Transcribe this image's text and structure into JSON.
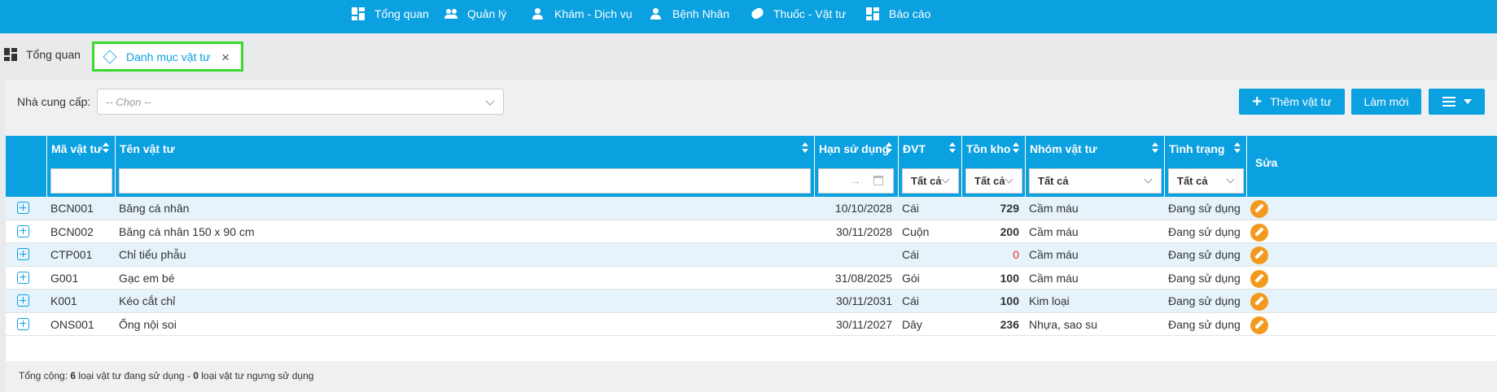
{
  "nav": {
    "items": [
      {
        "label": "Tổng quan",
        "icon": "dashboard-icon"
      },
      {
        "label": "Quản lý",
        "icon": "users-icon"
      },
      {
        "label": "Khám - Dịch vụ",
        "icon": "doctor-icon"
      },
      {
        "label": "Bệnh Nhân",
        "icon": "patient-icon"
      },
      {
        "label": "Thuốc - Vật tư",
        "icon": "pill-icon"
      },
      {
        "label": "Báo cáo",
        "icon": "report-icon"
      }
    ]
  },
  "tabs": {
    "home": "Tổng quan",
    "active": "Danh mục vật tư",
    "close": "×"
  },
  "toolbar": {
    "supplier_label": "Nhà cung cấp:",
    "supplier_placeholder": "-- Chọn --",
    "add_label": "Thêm vật tư",
    "refresh_label": "Làm mới"
  },
  "table": {
    "columns": {
      "code": "Mã vật tư",
      "name": "Tên vật tư",
      "expiry": "Hạn sử dụng",
      "unit": "ĐVT",
      "stock": "Tồn kho",
      "group": "Nhóm vật tư",
      "status": "Tình trạng",
      "edit": "Sửa"
    },
    "filters": {
      "unit": "Tất cả",
      "stock": "Tất cả",
      "group": "Tất cả",
      "status": "Tất cả",
      "date_arrow": "→"
    },
    "rows": [
      {
        "code": "BCN001",
        "name": "Băng cá nhân",
        "expiry": "10/10/2028",
        "unit": "Cái",
        "stock": "729",
        "group": "Cầm máu",
        "status": "Đang sử dụng"
      },
      {
        "code": "BCN002",
        "name": "Băng cá nhân 150 x 90 cm",
        "expiry": "30/11/2028",
        "unit": "Cuộn",
        "stock": "200",
        "group": "Cầm máu",
        "status": "Đang sử dụng"
      },
      {
        "code": "CTP001",
        "name": "Chỉ tiểu phẫu",
        "expiry": "",
        "unit": "Cái",
        "stock": "0",
        "group": "Cầm máu",
        "status": "Đang sử dụng"
      },
      {
        "code": "G001",
        "name": "Gạc em bé",
        "expiry": "31/08/2025",
        "unit": "Gói",
        "stock": "100",
        "group": "Cầm máu",
        "status": "Đang sử dụng"
      },
      {
        "code": "K001",
        "name": "Kéo cắt chỉ",
        "expiry": "30/11/2031",
        "unit": "Cái",
        "stock": "100",
        "group": "Kim loại",
        "status": "Đang sử dụng"
      },
      {
        "code": "ONS001",
        "name": "Ống nội soi",
        "expiry": "30/11/2027",
        "unit": "Dây",
        "stock": "236",
        "group": "Nhựa, sao su",
        "status": "Đang sử dụng"
      }
    ]
  },
  "footer": {
    "prefix": "Tổng cộng: ",
    "active_count": "6",
    "middle": " loại vật tư đang sử dụng - ",
    "inactive_count": "0",
    "suffix": " loại vật tư ngưng sử dụng"
  },
  "colors": {
    "primary": "#0ba0e0",
    "active_tab_border": "#3bd92f",
    "edit_button": "#f39a1e",
    "zero_stock": "#e03030"
  }
}
